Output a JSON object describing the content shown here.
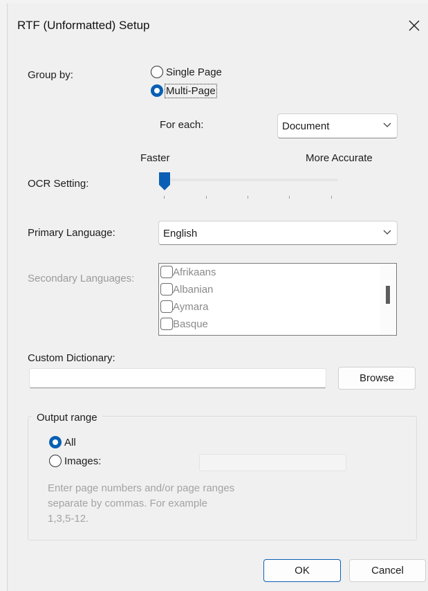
{
  "window": {
    "title": "RTF (Unformatted) Setup"
  },
  "group_by": {
    "label": "Group by:",
    "options": [
      {
        "label": "Single Page",
        "selected": false
      },
      {
        "label": "Multi-Page",
        "selected": true
      }
    ],
    "for_each_label": "For each:",
    "for_each_value": "Document"
  },
  "ocr": {
    "label": "OCR Setting:",
    "min_label": "Faster",
    "max_label": "More Accurate",
    "level": 0,
    "steps": 5
  },
  "primary_language": {
    "label": "Primary Language:",
    "value": "English"
  },
  "secondary_languages": {
    "label": "Secondary Languages:",
    "items": [
      "Afrikaans",
      "Albanian",
      "Aymara",
      "Basque"
    ]
  },
  "custom_dictionary": {
    "label": "Custom Dictionary:",
    "value": "",
    "browse_label": "Browse"
  },
  "output_range": {
    "legend": "Output range",
    "all_label": "All",
    "images_label": "Images:",
    "selected": "All",
    "images_value": "",
    "hint": "Enter page numbers and/or page ranges\nseparate by commas.  For example\n1,3,5-12."
  },
  "buttons": {
    "ok": "OK",
    "cancel": "Cancel"
  },
  "colors": {
    "accent": "#0a5fb4",
    "dialog_bg": "#f0f0f0",
    "disabled_text": "#9a9a9a"
  }
}
